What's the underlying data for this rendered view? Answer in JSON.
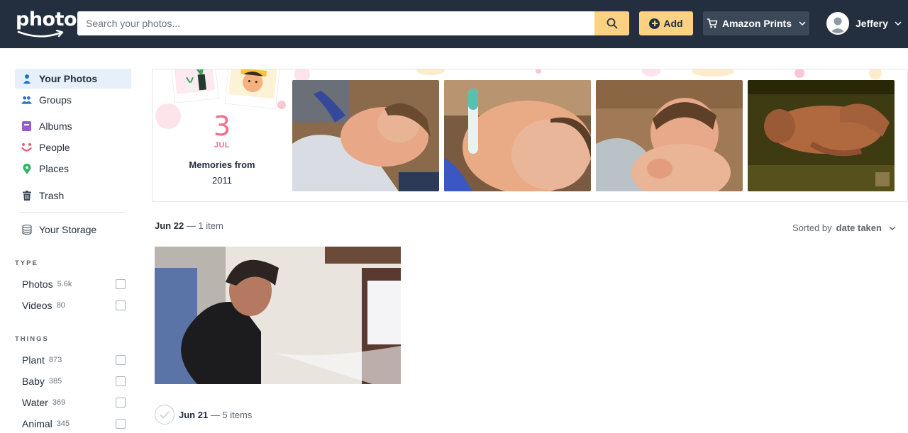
{
  "header": {
    "logo_text": "photos",
    "search_placeholder": "Search your photos...",
    "add_label": "Add",
    "prints_label": "Amazon Prints",
    "user_name": "Jeffery"
  },
  "sidebar": {
    "items": [
      {
        "label": "Your Photos",
        "icon": "person-icon",
        "active": true
      },
      {
        "label": "Groups",
        "icon": "groups-icon"
      },
      {
        "label": "Albums",
        "icon": "album-icon"
      },
      {
        "label": "People",
        "icon": "face-icon"
      },
      {
        "label": "Places",
        "icon": "location-pin-icon"
      },
      {
        "label": "Trash",
        "icon": "trash-icon"
      },
      {
        "label": "Your Storage",
        "icon": "storage-icon"
      }
    ],
    "type_label": "TYPE",
    "type_filters": [
      {
        "label": "Photos",
        "count": "5.6k"
      },
      {
        "label": "Videos",
        "count": "80"
      }
    ],
    "things_label": "THINGS",
    "things_filters": [
      {
        "label": "Plant",
        "count": "873"
      },
      {
        "label": "Baby",
        "count": "385"
      },
      {
        "label": "Water",
        "count": "369"
      },
      {
        "label": "Animal",
        "count": "345"
      }
    ]
  },
  "memories": {
    "day": "3",
    "month": "JUL",
    "title": "Memories from",
    "year": "2011"
  },
  "timeline": {
    "group1_date": "Jun 22",
    "group1_count": "— 1 item",
    "group2_date": "Jun 21",
    "group2_count": "— 5 items",
    "sort_prefix": "Sorted by",
    "sort_value": "date taken"
  },
  "colors": {
    "header_bg": "#232f3e",
    "accent": "#fcd282",
    "active_bg": "#e7f0fa",
    "memory_pink": "#ef6e8a"
  }
}
